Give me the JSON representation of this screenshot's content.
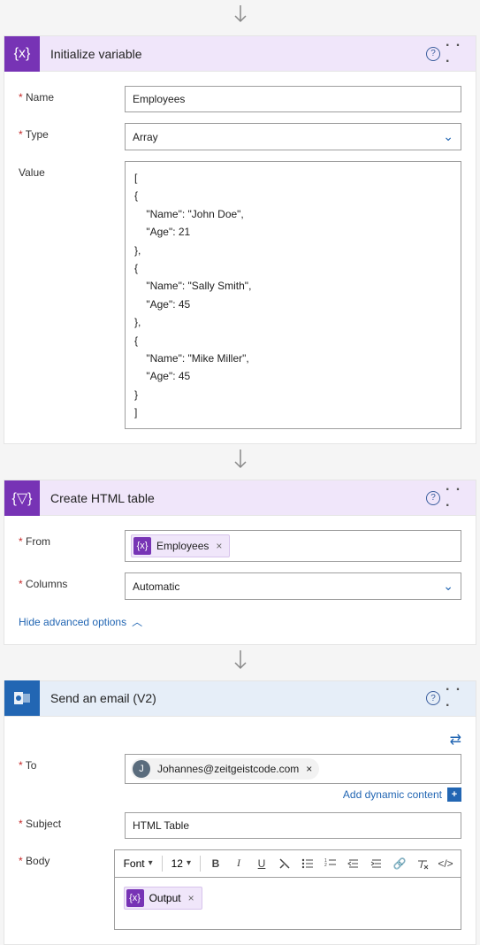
{
  "connector_arrow": "↓",
  "actions": {
    "init": {
      "title": "Initialize variable",
      "labels": {
        "name": "Name",
        "type": "Type",
        "value": "Value"
      },
      "name_value": "Employees",
      "type_value": "Array",
      "value_text": "[\n{\n    \"Name\": \"John Doe\",\n    \"Age\": 21\n},\n{\n    \"Name\": \"Sally Smith\",\n    \"Age\": 45\n},\n{\n    \"Name\": \"Mike Miller\",\n    \"Age\": 45\n}\n]"
    },
    "html": {
      "title": "Create HTML table",
      "labels": {
        "from": "From",
        "columns": "Columns"
      },
      "from_token": "Employees",
      "columns_value": "Automatic",
      "advanced_link": "Hide advanced options"
    },
    "email": {
      "title": "Send an email (V2)",
      "labels": {
        "to": "To",
        "subject": "Subject",
        "body": "Body"
      },
      "to_value": "Johannes@zeitgeistcode.com",
      "to_initial": "J",
      "dyn_link": "Add dynamic content",
      "subject_value": "HTML Table",
      "toolbar": {
        "font_label": "Font",
        "size_label": "12",
        "bold": "B",
        "italic": "I",
        "underline": "U"
      },
      "body_token": "Output"
    }
  },
  "icons": {
    "help": "?",
    "menu": "· · ·",
    "close": "×",
    "chevron_down": "▾",
    "chevron_up": "︿",
    "swap": "⇄",
    "plus": "+",
    "var_fx": "{x}",
    "table_fx": "{▽}",
    "mail": "✉",
    "code": "</>",
    "link": "🔗"
  }
}
